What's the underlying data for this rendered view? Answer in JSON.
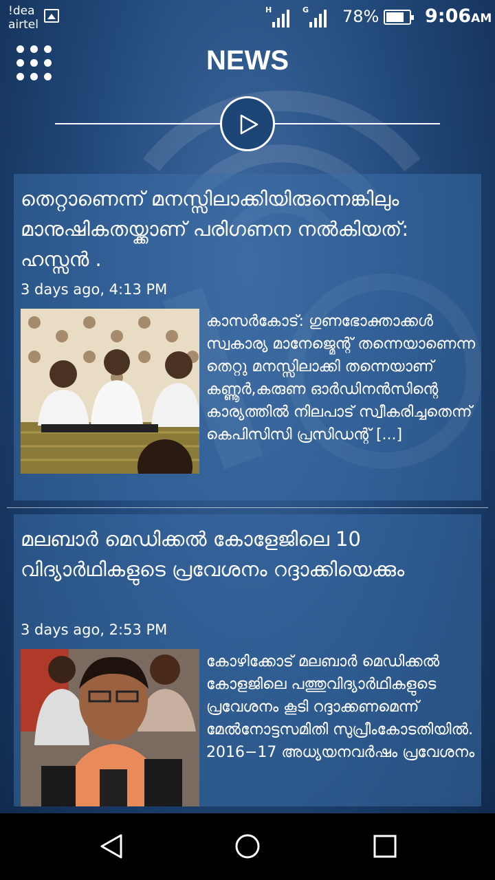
{
  "status_bar": {
    "carrier_line1": "!dea",
    "carrier_line2": "airtel",
    "signal1_type": "H",
    "signal2_type": "G",
    "battery_percent": "78%",
    "battery_level": 0.78,
    "time": "9:06",
    "time_suffix": "AM"
  },
  "header": {
    "title": "NEWS",
    "menu_icon": "grid-menu-icon",
    "play_icon": "play-icon"
  },
  "articles": [
    {
      "title": "തെറ്റാണെന്ന് മനസ്സിലാക്കിയിരുന്നെങ്കിലും മാനുഷികതയ്ക്കാണ് പരിഗണന നൽകിയത്: ഹസ്സൻ .",
      "date": "3 days ago, 4:13 PM",
      "excerpt": "കാസർകോട്: ഗുണഭോക്താക്കൾ സ്വകാര്യ മാനേജ്മെന്റ് തന്നെയാണെന്ന തെറ്റു മനസ്സിലാക്കി തന്നെയാണ് കണ്ണൂർ,കരുണ ഓർഡിനൻസിന്റെ കാര്യത്തിൽ നിലപാട് സ്വീകരിച്ചതെന്ന് കെപിസിസി പ്രസിഡന്റ് [...]"
    },
    {
      "title": "മലബാർ മെഡിക്കൽ കോളേജിലെ 10 വിദ്യാർഥികളുടെ പ്രവേശനം റദ്ദാക്കിയെക്കും",
      "date": "3 days ago, 2:53 PM",
      "excerpt": "കോഴിക്കോട് മലബാർ മെഡിക്കൽ കോളജിലെ പത്തുവിദ്യാർഥികളുടെ പ്രവേശനം കൂടി റദ്ദാക്കണമെന്ന് മേൽനോട്ടസമിതി സുപ്രീംകോടതിയിൽ. 2016−17 അധ്യയനവർഷം പ്രവേശനം"
    }
  ],
  "navbar": {
    "back_icon": "back-triangle-icon",
    "home_icon": "home-circle-icon",
    "recents_icon": "recents-square-icon"
  }
}
